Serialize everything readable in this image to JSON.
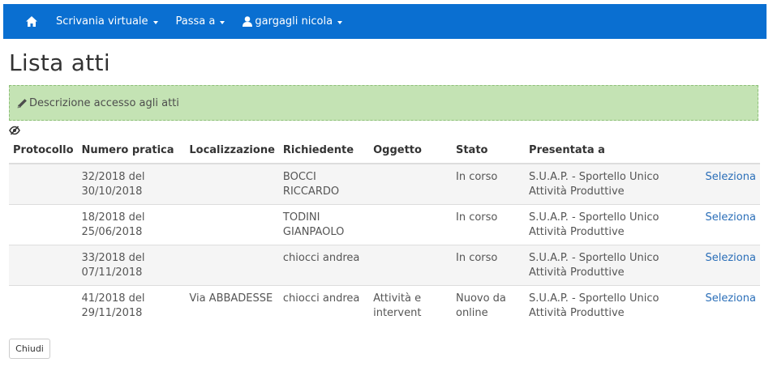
{
  "navbar": {
    "home_icon": "home-icon",
    "menus": [
      {
        "label": "Scrivania virtuale"
      },
      {
        "label": "Passa a"
      }
    ],
    "user": {
      "icon": "user-icon",
      "name": "gargagli nicola"
    },
    "background": "#0a6fd1"
  },
  "page": {
    "title": "Lista atti"
  },
  "description": {
    "icon": "pencil-icon",
    "label": "Descrizione accesso agli atti",
    "background": "#c4e3b4"
  },
  "visibility_toggle": {
    "icon": "eye-slash-icon"
  },
  "table": {
    "headers": [
      "Protocollo",
      "Numero pratica",
      "Localizzazione",
      "Richiedente",
      "Oggetto",
      "Stato",
      "Presentata a"
    ],
    "rows": [
      {
        "protocollo": "",
        "numero": "32/2018 del 30/10/2018",
        "localizzazione": "",
        "richiedente": "BOCCI RICCARDO",
        "oggetto": "",
        "stato": "In corso",
        "presentata": "S.U.A.P. - Sportello Unico Attività Produttive",
        "action": "Seleziona"
      },
      {
        "protocollo": "",
        "numero": "18/2018 del 25/06/2018",
        "localizzazione": "",
        "richiedente": "TODINI GIANPAOLO",
        "oggetto": "",
        "stato": "In corso",
        "presentata": "S.U.A.P. - Sportello Unico Attività Produttive",
        "action": "Seleziona"
      },
      {
        "protocollo": "",
        "numero": "33/2018 del 07/11/2018",
        "localizzazione": "",
        "richiedente": "chiocci andrea",
        "oggetto": "",
        "stato": "In corso",
        "presentata": "S.U.A.P. - Sportello Unico Attività Produttive",
        "action": "Seleziona"
      },
      {
        "protocollo": "",
        "numero": "41/2018 del 29/11/2018",
        "localizzazione": "Via ABBADESSE",
        "richiedente": "chiocci andrea",
        "oggetto": "Attività e intervent",
        "stato": "Nuovo da online",
        "presentata": "S.U.A.P. - Sportello Unico Attività Produttive",
        "action": "Seleziona"
      }
    ]
  },
  "footer": {
    "close_label": "Chiudi"
  }
}
